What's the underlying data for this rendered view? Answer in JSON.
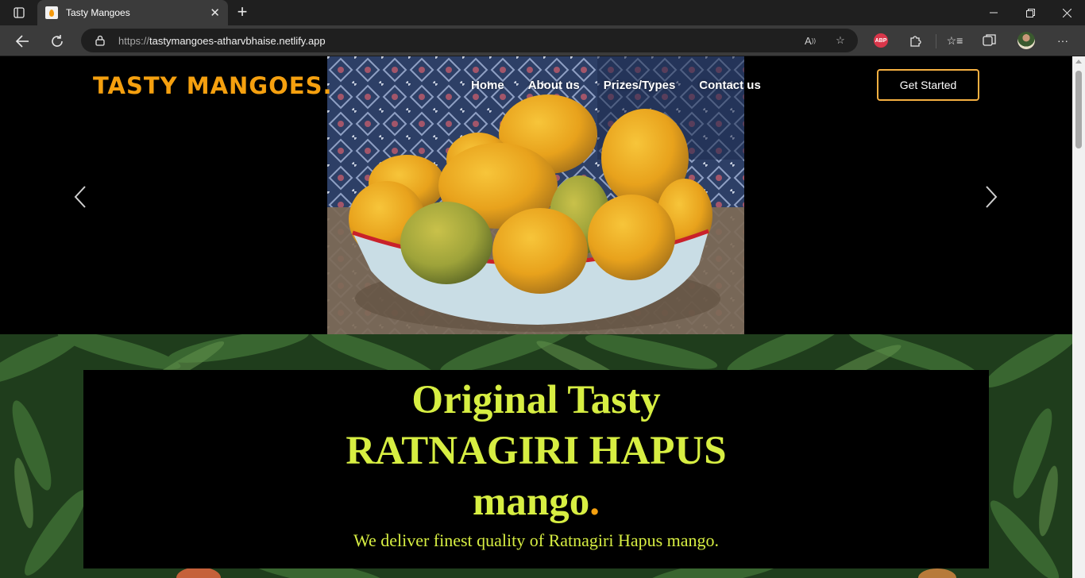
{
  "browser": {
    "tab_title": "Tasty Mangoes",
    "url_prefix": "https://",
    "url_host": "tastymangoes-atharvbhaise.netlify.app",
    "abp_label": "ABP"
  },
  "site": {
    "brand": "TASTY MANGOES.",
    "nav": [
      "Home",
      "About us",
      "Prizes/Types",
      "Contact us"
    ],
    "cta": "Get Started"
  },
  "banner": {
    "line1": "Original Tasty",
    "line2": "RATNAGIRI HAPUS",
    "line3": "mango",
    "line3_dot": ".",
    "subtitle": "We deliver finest quality of Ratnagiri Hapus mango."
  },
  "colors": {
    "brand": "#f5a00f",
    "headline": "#d7ee42",
    "cta_border": "#f5b041"
  }
}
